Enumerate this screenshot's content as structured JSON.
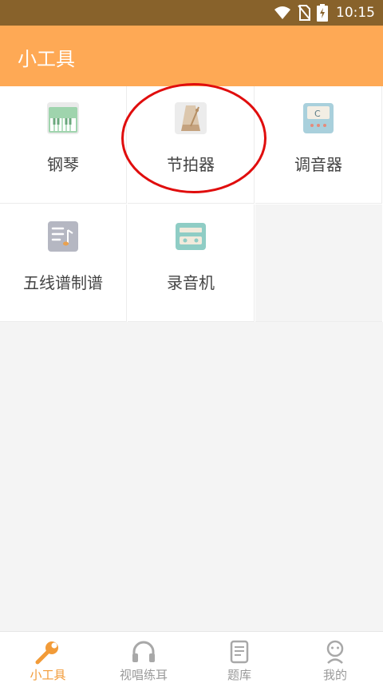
{
  "status_bar": {
    "time": "10:15"
  },
  "app_bar": {
    "title": "小工具"
  },
  "tools": [
    {
      "label": "钢琴",
      "icon": "piano-icon"
    },
    {
      "label": "节拍器",
      "icon": "metronome-icon"
    },
    {
      "label": "调音器",
      "icon": "tuner-icon"
    },
    {
      "label": "五线谱制谱",
      "icon": "staff-notation-icon"
    },
    {
      "label": "录音机",
      "icon": "recorder-icon"
    }
  ],
  "bottom_nav": [
    {
      "label": "小工具",
      "icon": "wrench-icon",
      "active": true
    },
    {
      "label": "视唱练耳",
      "icon": "headphones-icon",
      "active": false
    },
    {
      "label": "题库",
      "icon": "scroll-icon",
      "active": false
    },
    {
      "label": "我的",
      "icon": "profile-icon",
      "active": false
    }
  ],
  "colors": {
    "status_bar": "#88622b",
    "app_bar": "#fea955",
    "active_tab": "#f29b38",
    "highlight": "#e00d0d"
  }
}
